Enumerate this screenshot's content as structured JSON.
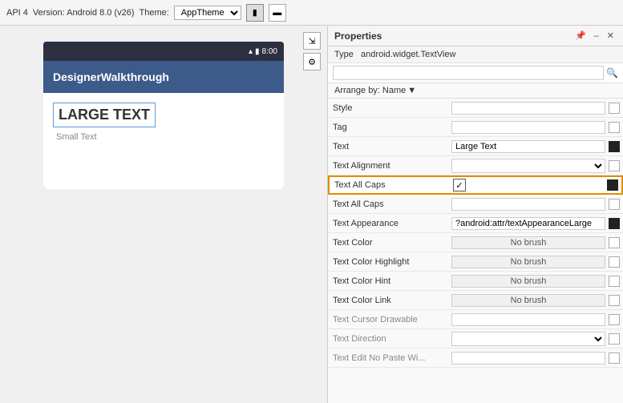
{
  "topbar": {
    "api_label": "API 4",
    "version_label": "Version: Android 8.0 (v26)",
    "theme_label": "Theme:",
    "theme_value": "AppTheme"
  },
  "device": {
    "time": "8:00",
    "app_title": "DesignerWalkthrough",
    "large_text": "LARGE TEXT",
    "small_text": "Small Text"
  },
  "properties": {
    "panel_title": "Properties",
    "type_label": "Type",
    "type_value": "android.widget.TextView",
    "search_placeholder": "",
    "arrange_label": "Arrange by: Name",
    "rows": [
      {
        "name": "Style",
        "type": "input",
        "value": ""
      },
      {
        "name": "Tag",
        "type": "input",
        "value": ""
      },
      {
        "name": "Text",
        "type": "input",
        "value": "Large Text"
      },
      {
        "name": "Text Alignment",
        "type": "dropdown",
        "value": ""
      },
      {
        "name": "Text All Caps",
        "type": "checkbox_highlighted",
        "value": "checked"
      },
      {
        "name": "Text All Caps",
        "type": "input",
        "value": ""
      },
      {
        "name": "Text Appearance",
        "type": "appearance",
        "value": "?android:attr/textAppearanceLarge"
      },
      {
        "name": "Text Color",
        "type": "nobrush",
        "value": "No brush"
      },
      {
        "name": "Text Color Highlight",
        "type": "nobrush",
        "value": "No brush"
      },
      {
        "name": "Text Color Hint",
        "type": "nobrush",
        "value": "No brush"
      },
      {
        "name": "Text Color Link",
        "type": "nobrush",
        "value": "No brush"
      },
      {
        "name": "Text Cursor Drawable",
        "type": "input_muted",
        "value": ""
      },
      {
        "name": "Text Direction",
        "type": "dropdown_muted",
        "value": ""
      },
      {
        "name": "Text Edit No Paste Wi...",
        "type": "input_muted",
        "value": ""
      }
    ]
  }
}
